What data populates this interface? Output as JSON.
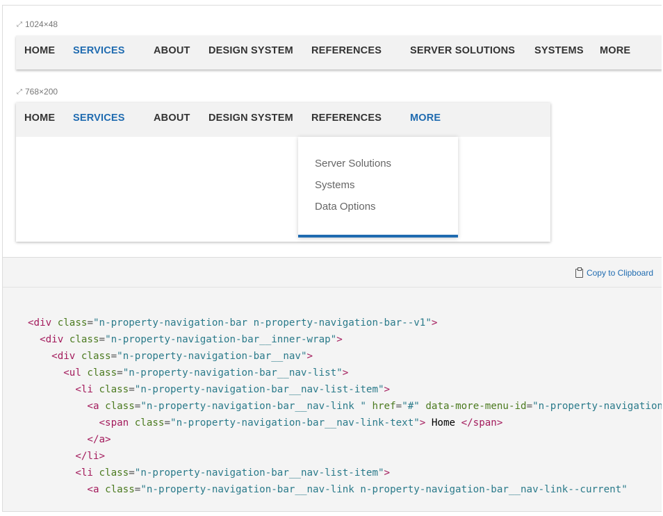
{
  "demo1": {
    "size_label": "1024×48",
    "nav_items": [
      "HOME",
      "SERVICES",
      "ABOUT",
      "DESIGN SYSTEM",
      "REFERENCES",
      "SERVER SOLUTIONS",
      "SYSTEMS",
      "MORE"
    ],
    "active_index": 1
  },
  "demo2": {
    "size_label": "768×200",
    "nav_items": [
      "HOME",
      "SERVICES",
      "ABOUT",
      "DESIGN SYSTEM",
      "REFERENCES",
      "MORE"
    ],
    "active_indices": [
      1,
      5
    ],
    "dropdown_items": [
      "Server Solutions",
      "Systems",
      "Data Options"
    ]
  },
  "code_panel": {
    "copy_label": "Copy to Clipboard",
    "lines": [
      {
        "indent": 0,
        "parts": [
          [
            "tag",
            "<div"
          ],
          [
            "sp",
            " "
          ],
          [
            "attr",
            "class"
          ],
          [
            "punct",
            "="
          ],
          [
            "val",
            "\"n-property-navigation-bar n-property-navigation-bar--v1\""
          ],
          [
            "tag",
            ">"
          ]
        ]
      },
      {
        "indent": 1,
        "parts": [
          [
            "tag",
            "<div"
          ],
          [
            "sp",
            " "
          ],
          [
            "attr",
            "class"
          ],
          [
            "punct",
            "="
          ],
          [
            "val",
            "\"n-property-navigation-bar__inner-wrap\""
          ],
          [
            "tag",
            ">"
          ]
        ]
      },
      {
        "indent": 2,
        "parts": [
          [
            "tag",
            "<div"
          ],
          [
            "sp",
            " "
          ],
          [
            "attr",
            "class"
          ],
          [
            "punct",
            "="
          ],
          [
            "val",
            "\"n-property-navigation-bar__nav\""
          ],
          [
            "tag",
            ">"
          ]
        ]
      },
      {
        "indent": 3,
        "parts": [
          [
            "tag",
            "<ul"
          ],
          [
            "sp",
            " "
          ],
          [
            "attr",
            "class"
          ],
          [
            "punct",
            "="
          ],
          [
            "val",
            "\"n-property-navigation-bar__nav-list\""
          ],
          [
            "tag",
            ">"
          ]
        ]
      },
      {
        "indent": 4,
        "parts": [
          [
            "tag",
            "<li"
          ],
          [
            "sp",
            " "
          ],
          [
            "attr",
            "class"
          ],
          [
            "punct",
            "="
          ],
          [
            "val",
            "\"n-property-navigation-bar__nav-list-item\""
          ],
          [
            "tag",
            ">"
          ]
        ]
      },
      {
        "indent": 5,
        "parts": [
          [
            "tag",
            "<a"
          ],
          [
            "sp",
            " "
          ],
          [
            "attr",
            "class"
          ],
          [
            "punct",
            "="
          ],
          [
            "val",
            "\"n-property-navigation-bar__nav-link \""
          ],
          [
            "sp",
            " "
          ],
          [
            "attr",
            "href"
          ],
          [
            "punct",
            "="
          ],
          [
            "val",
            "\"#\""
          ],
          [
            "sp",
            " "
          ],
          [
            "attr",
            "data-more-menu-id"
          ],
          [
            "punct",
            "="
          ],
          [
            "val",
            "\"n-property-navigation-bar__nav-link--home\""
          ]
        ]
      },
      {
        "indent": 6,
        "parts": [
          [
            "tag",
            "<span"
          ],
          [
            "sp",
            " "
          ],
          [
            "attr",
            "class"
          ],
          [
            "punct",
            "="
          ],
          [
            "val",
            "\"n-property-navigation-bar__nav-link-text\""
          ],
          [
            "tag",
            ">"
          ],
          [
            "txt",
            " Home "
          ],
          [
            "tag",
            "</span>"
          ]
        ]
      },
      {
        "indent": 5,
        "parts": [
          [
            "tag",
            "</a>"
          ]
        ]
      },
      {
        "indent": 4,
        "parts": [
          [
            "tag",
            "</li>"
          ]
        ]
      },
      {
        "indent": 4,
        "parts": [
          [
            "tag",
            "<li"
          ],
          [
            "sp",
            " "
          ],
          [
            "attr",
            "class"
          ],
          [
            "punct",
            "="
          ],
          [
            "val",
            "\"n-property-navigation-bar__nav-list-item\""
          ],
          [
            "tag",
            ">"
          ]
        ]
      },
      {
        "indent": 5,
        "parts": [
          [
            "tag",
            "<a"
          ],
          [
            "sp",
            " "
          ],
          [
            "attr",
            "class"
          ],
          [
            "punct",
            "="
          ],
          [
            "val",
            "\"n-property-navigation-bar__nav-link n-property-navigation-bar__nav-link--current\""
          ]
        ]
      }
    ]
  }
}
